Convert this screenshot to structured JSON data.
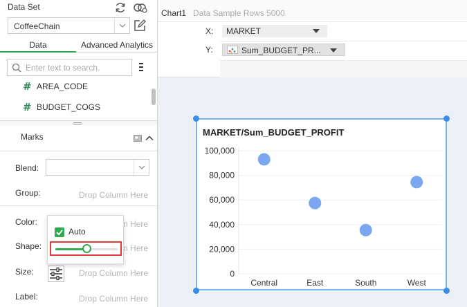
{
  "left_panel": {
    "dataset_label": "Data Set",
    "dataset_value": "CoffeeChain",
    "tabs": [
      {
        "label": "Data"
      },
      {
        "label": "Advanced Analytics"
      }
    ],
    "search_placeholder": "Enter text to search.",
    "fields": [
      {
        "name": "AREA_CODE",
        "type_icon": "#"
      },
      {
        "name": "BUDGET_COGS",
        "type_icon": "#"
      }
    ],
    "marks": {
      "title": "Marks",
      "blend_label": "Blend:",
      "group_label": "Group:",
      "group_hint": "Drop Column Here",
      "color_label": "Color:",
      "color_hint": "Drop Column Here",
      "shape_label": "Shape:",
      "shape_hint": "Drop Column Here",
      "size_label": "Size:",
      "size_hint": "Drop Column Here",
      "label_label": "Label:",
      "label_hint": "Drop Column Here"
    },
    "color_popup": {
      "auto_label": "Auto",
      "auto_checked": true,
      "slider_value": 0.5
    }
  },
  "top_bar": {
    "chart_name": "Chart1",
    "sample_rows": "Data Sample Rows 5000"
  },
  "binding": {
    "x_label": "X:",
    "x_field": "MARKET",
    "y_label": "Y:",
    "y_field": "Sum_BUDGET_PR..."
  },
  "colors": {
    "accent_green": "#2eaa4f",
    "point_blue": "#7aa7f0",
    "selection_blue": "#3a8ee6",
    "highlight_red": "#e03a3a"
  },
  "chart_data": {
    "type": "scatter",
    "title": "MARKET/Sum_BUDGET_PROFIT",
    "categories": [
      "Central",
      "East",
      "South",
      "West"
    ],
    "values": [
      93000,
      57500,
      35500,
      74500
    ],
    "ylim": [
      0,
      100000
    ],
    "yticks": [
      0,
      20000,
      40000,
      60000,
      80000,
      100000
    ],
    "ytick_labels": [
      "0",
      "20,000",
      "40,000",
      "60,000",
      "80,000",
      "100,000"
    ],
    "grid": true,
    "xlabel": "",
    "ylabel": ""
  }
}
